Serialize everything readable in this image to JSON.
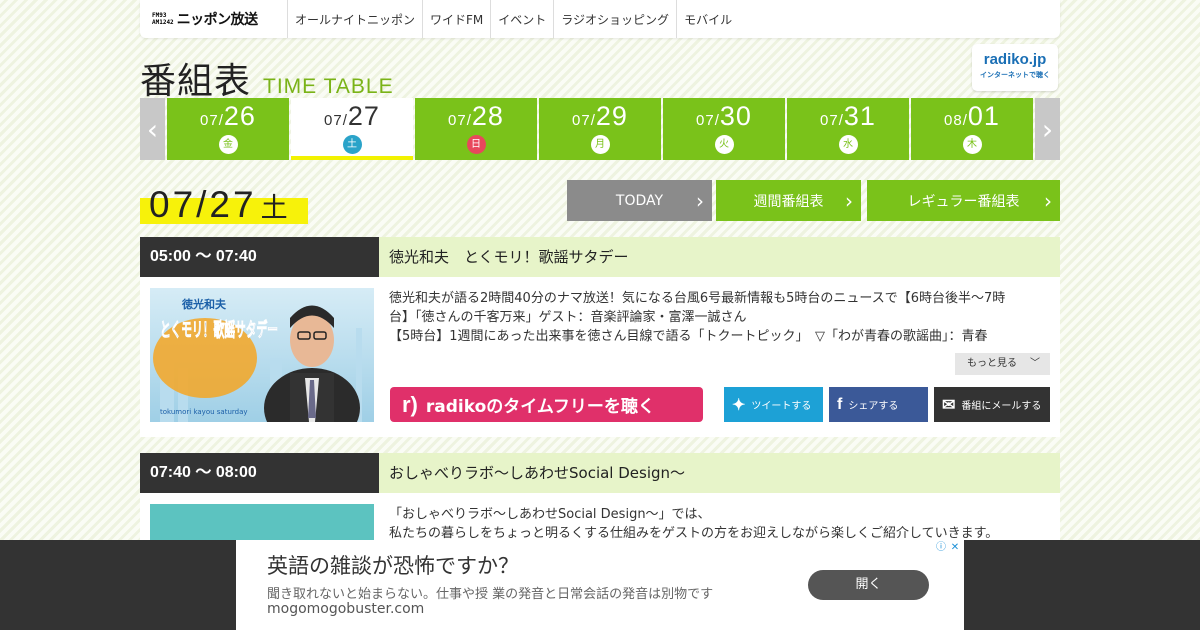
{
  "nav": {
    "logo_fm": "FM93\nAM1242",
    "logo_name": "ニッポン放送",
    "items": [
      "オールナイトニッポン",
      "ワイドFM",
      "イベント",
      "ラジオショッピング",
      "モバイル"
    ]
  },
  "header": {
    "title_ja": "番組表",
    "title_en": "TIME TABLE",
    "radiko_badge": "radiko.jp",
    "radiko_badge_sub": "インターネットで聴く"
  },
  "dates": [
    {
      "month": "07/",
      "day": "26",
      "dow": "金",
      "active": false,
      "sunday": false
    },
    {
      "month": "07/",
      "day": "27",
      "dow": "土",
      "active": true,
      "sunday": false
    },
    {
      "month": "07/",
      "day": "28",
      "dow": "日",
      "active": false,
      "sunday": true
    },
    {
      "month": "07/",
      "day": "29",
      "dow": "月",
      "active": false,
      "sunday": false
    },
    {
      "month": "07/",
      "day": "30",
      "dow": "火",
      "active": false,
      "sunday": false
    },
    {
      "month": "07/",
      "day": "31",
      "dow": "水",
      "active": false,
      "sunday": false
    },
    {
      "month": "08/",
      "day": "01",
      "dow": "木",
      "active": false,
      "sunday": false
    }
  ],
  "current": {
    "date": "07/27",
    "dow": "土"
  },
  "buttons": {
    "today": "TODAY",
    "weekly": "週間番組表",
    "regular": "レギュラー番組表"
  },
  "programs": [
    {
      "time": "05:00 ～ 07:40",
      "title": "徳光和夫　とくモリ！歌謡サタデー",
      "desc": [
        "徳光和夫が語る2時間40分のナマ放送！気になる台風6号最新情報も5時台のニュースで【6時台後半～7時",
        "台】「徳さんの千客万来」ゲスト：音楽評論家・富澤一誠さん",
        "【5時台】1週間にあった出来事を徳さん目線で語る「トクートピック」　▽「わが青春の歌謡曲」：青春"
      ],
      "more": "もっと見る",
      "radiko": "radikoのタイムフリーを聴く",
      "tweet": "ツイートする",
      "share": "シェアする",
      "mail": "番組にメールする",
      "thumb_title": "とくモリ！歌謡サタデー",
      "thumb_top": "徳光和夫",
      "thumb_sub": "tokumori kayou saturday"
    },
    {
      "time": "07:40 ～ 08:00",
      "title": "おしゃべりラボ～しあわせSocial Design～",
      "desc": [
        "「おしゃべりラボ～しあわせSocial Design～」では、",
        "私たちの暮らしをちょっと明るくする仕組みをゲストの方をお迎えしながら楽しくご紹介していきます。"
      ]
    }
  ],
  "ad": {
    "headline": "英語の雑談が恐怖ですか？",
    "sub": "聞き取れないと始まらない。仕事や授 業の発音と日常会話の発音は別物です",
    "url": "mogomogobuster.com",
    "button": "開く"
  }
}
